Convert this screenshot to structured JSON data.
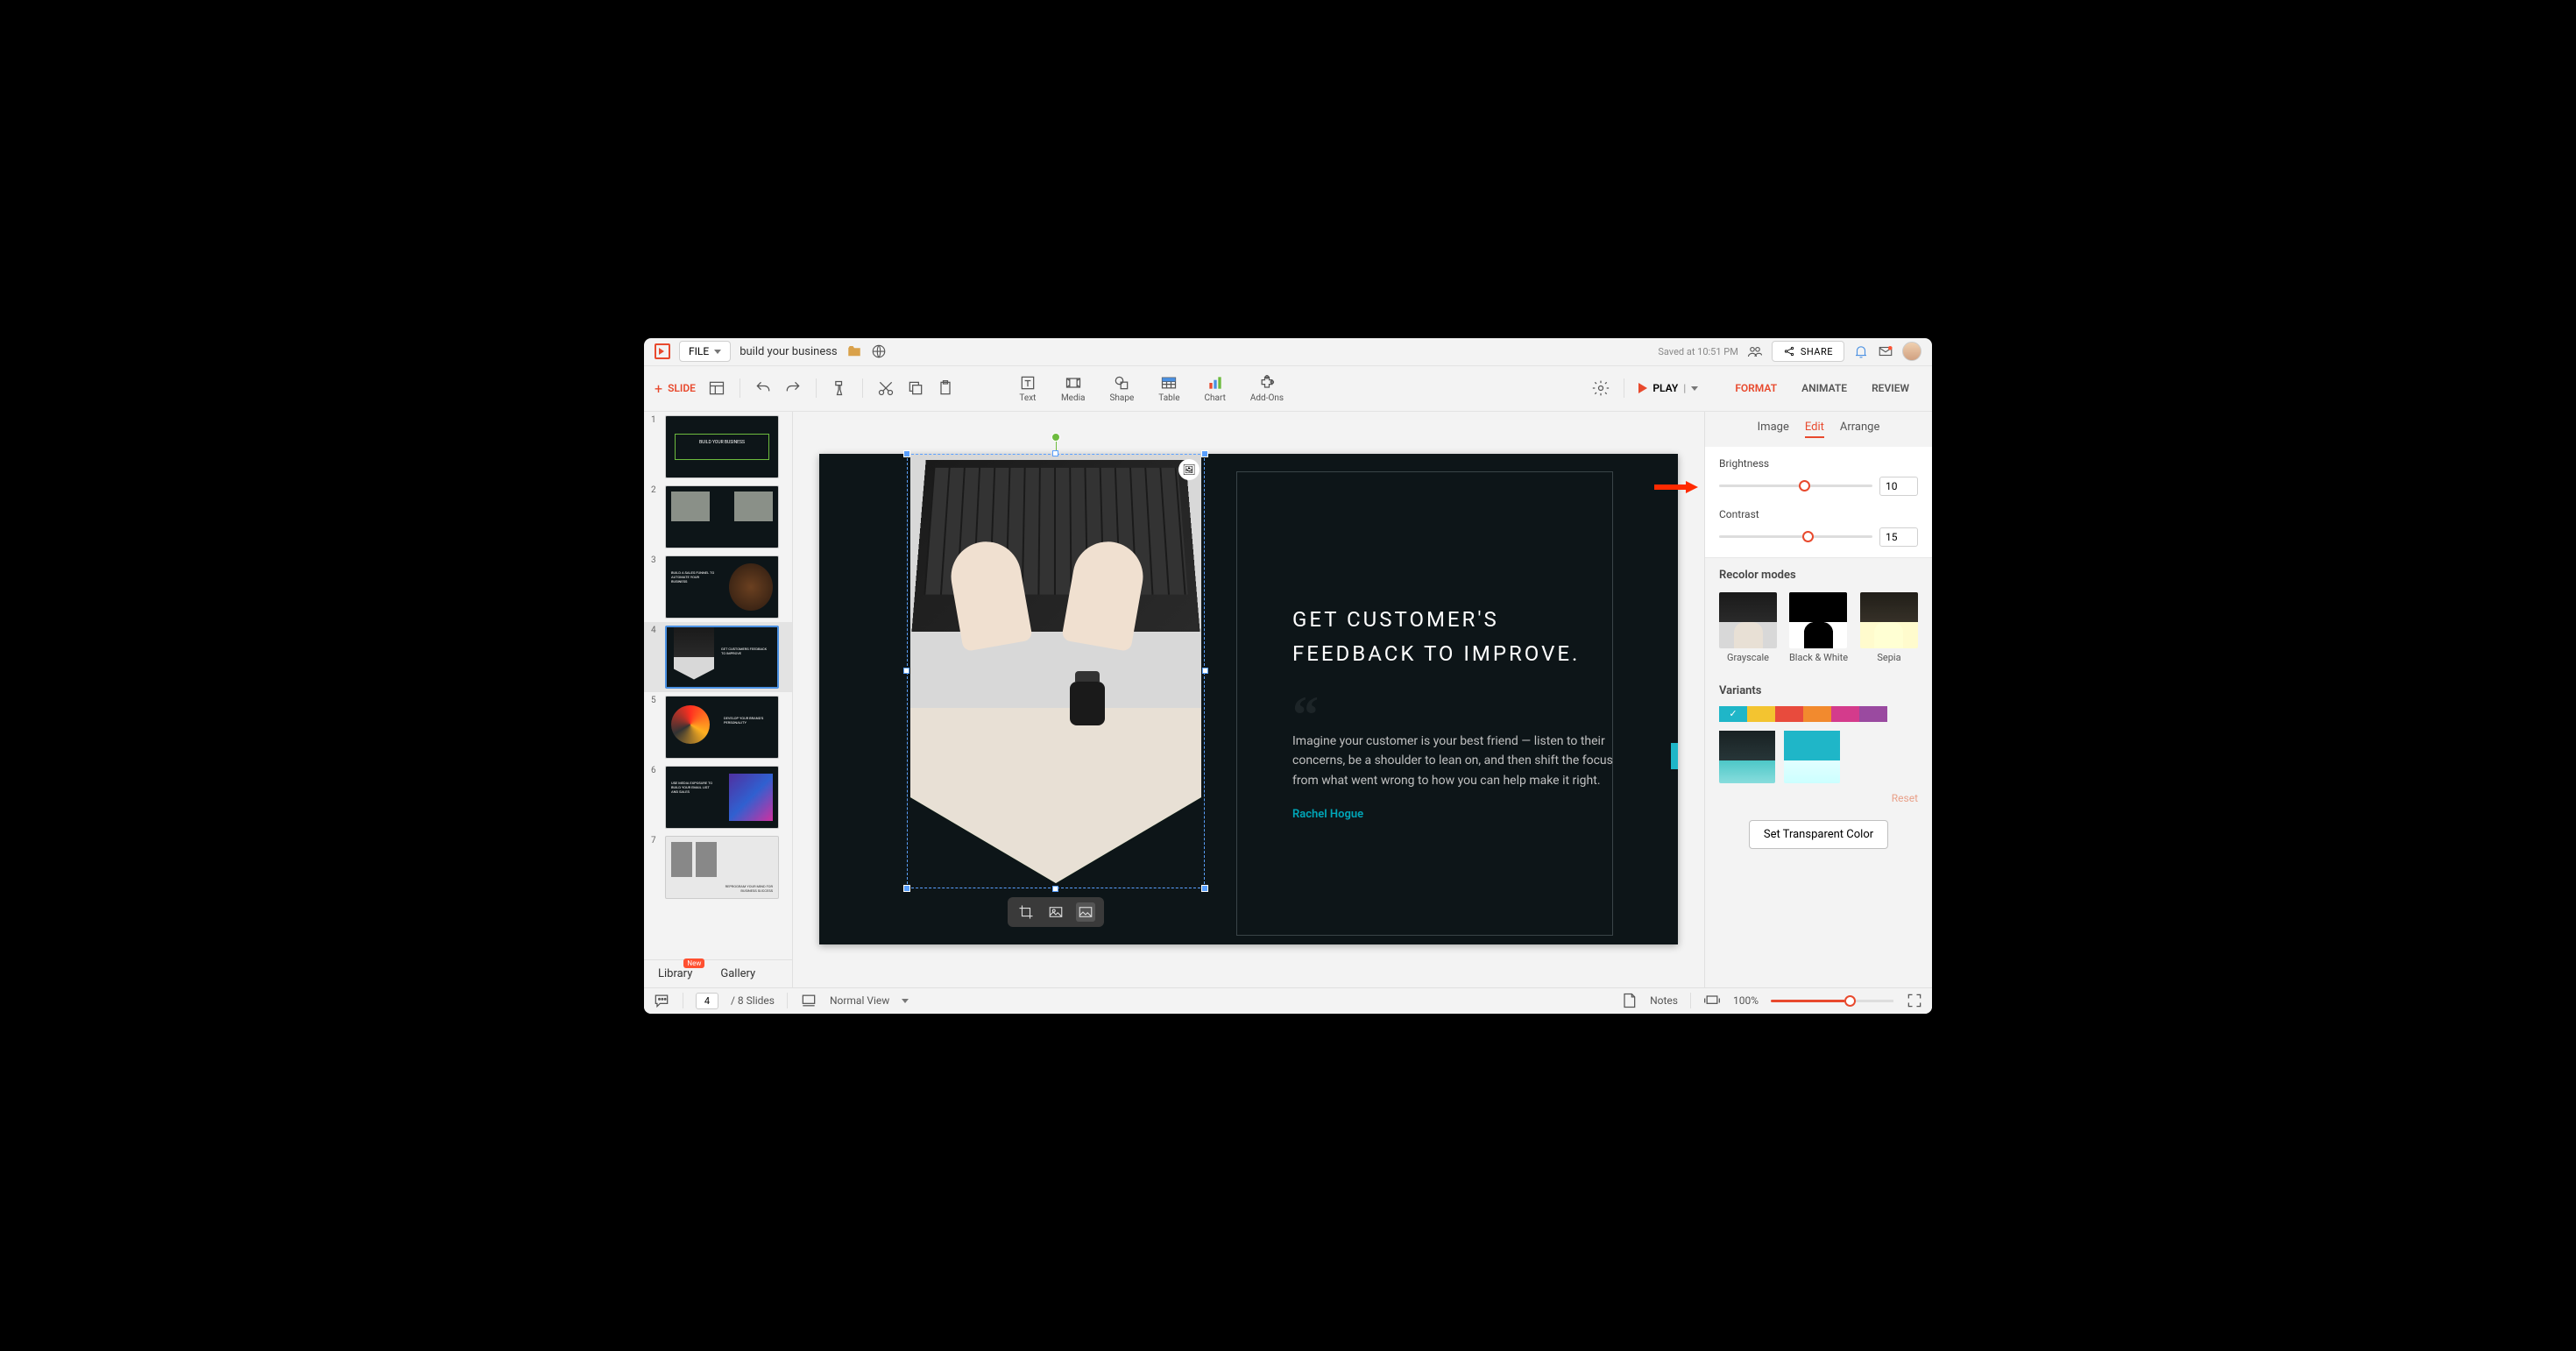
{
  "topbar": {
    "file_label": "FILE",
    "doc_title": "build your business",
    "saved_text": "Saved at 10:51 PM",
    "share_label": "SHARE"
  },
  "toolbar": {
    "slide_label": "SLIDE",
    "insert": {
      "text": "Text",
      "media": "Media",
      "shape": "Shape",
      "table": "Table",
      "chart": "Chart",
      "addons": "Add-Ons"
    },
    "play_label": "PLAY",
    "tabs": {
      "format": "FORMAT",
      "animate": "ANIMATE",
      "review": "REVIEW"
    }
  },
  "thumbs": {
    "items": [
      {
        "num": "1"
      },
      {
        "num": "2"
      },
      {
        "num": "3"
      },
      {
        "num": "4"
      },
      {
        "num": "5"
      },
      {
        "num": "6"
      },
      {
        "num": "7"
      }
    ],
    "bottom_tabs": {
      "library": "Library",
      "library_badge": "New",
      "gallery": "Gallery"
    }
  },
  "slide": {
    "headline_line1": "GET CUSTOMER'S",
    "headline_line2": "FEEDBACK  TO IMPROVE.",
    "body": "Imagine your customer is your best friend — listen to their concerns, be a shoulder to lean on, and then shift the focus from what went wrong to how you can help make it right.",
    "author": "Rachel Hogue"
  },
  "right_panel": {
    "subtabs": {
      "image": "Image",
      "edit": "Edit",
      "arrange": "Arrange"
    },
    "brightness_label": "Brightness",
    "brightness_value": "10",
    "contrast_label": "Contrast",
    "contrast_value": "15",
    "recolor_heading": "Recolor modes",
    "recolor": {
      "grayscale": "Grayscale",
      "bw": "Black & White",
      "sepia": "Sepia"
    },
    "variants_heading": "Variants",
    "variant_colors": [
      "#1fb6c8",
      "#f3c430",
      "#e84b3d",
      "#f28a2e",
      "#d43b8c",
      "#9a4aa0"
    ],
    "reset_label": "Reset",
    "transparent_btn": "Set Transparent Color"
  },
  "statusbar": {
    "current_slide": "4",
    "slide_count_text": "/  8 Slides",
    "view_mode": "Normal View",
    "notes_label": "Notes",
    "zoom_value": "100%"
  }
}
